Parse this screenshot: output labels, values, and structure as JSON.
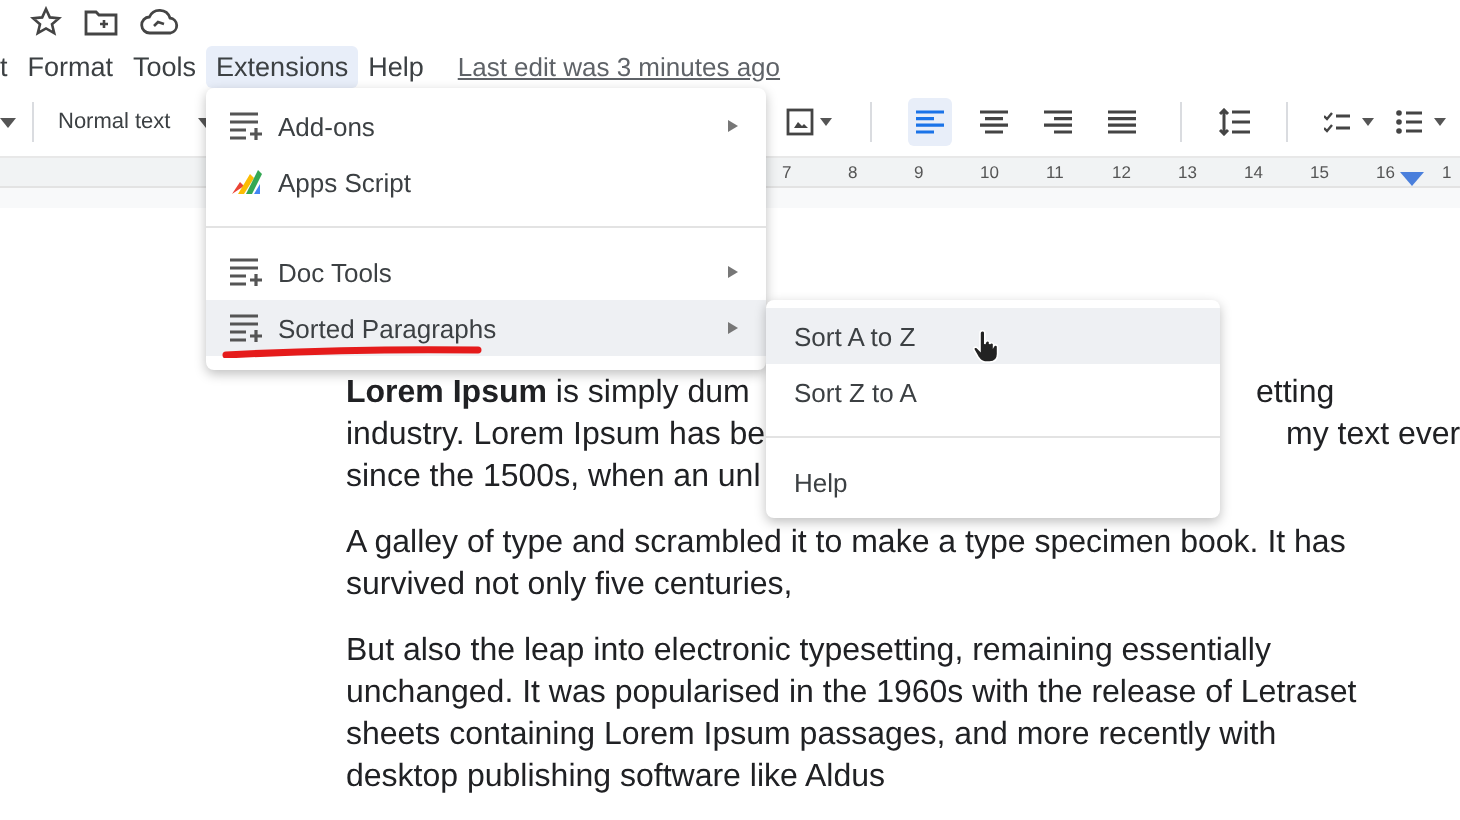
{
  "menu_bar": {
    "items": [
      {
        "label": "t",
        "selected": false
      },
      {
        "label": "Format",
        "selected": false
      },
      {
        "label": "Tools",
        "selected": false
      },
      {
        "label": "Extensions",
        "selected": true
      },
      {
        "label": "Help",
        "selected": false
      }
    ],
    "last_edit": "Last edit was 3 minutes ago"
  },
  "toolbar": {
    "style_dropdown": "Normal text",
    "align_buttons": [
      {
        "kind": "left",
        "selected": true
      },
      {
        "kind": "center",
        "selected": false
      },
      {
        "kind": "right",
        "selected": false
      },
      {
        "kind": "justify",
        "selected": false
      }
    ]
  },
  "ruler": {
    "marks": [
      "7",
      "8",
      "9",
      "10",
      "11",
      "12",
      "13",
      "14",
      "15",
      "16",
      "1"
    ]
  },
  "extensions_menu": {
    "sections": [
      [
        {
          "label": "Add-ons",
          "kind": "addon",
          "submenu": true,
          "selected": false
        },
        {
          "label": "Apps Script",
          "kind": "script",
          "submenu": false,
          "selected": false
        }
      ],
      [
        {
          "label": "Doc Tools",
          "kind": "addon",
          "submenu": true,
          "selected": false
        },
        {
          "label": "Sorted Paragraphs",
          "kind": "addon",
          "submenu": true,
          "selected": true
        }
      ]
    ]
  },
  "submenu": {
    "sections": [
      [
        {
          "label": "Sort A to Z",
          "selected": true
        },
        {
          "label": "Sort Z to A",
          "selected": false
        }
      ],
      [
        {
          "label": "Help",
          "selected": false
        }
      ]
    ]
  },
  "document": {
    "paragraphs": [
      [
        {
          "left": "**Lorem Ipsum** is simply dum",
          "right": "etting"
        },
        {
          "left": "industry. Lorem Ipsum has be",
          "right": "my text ever"
        },
        {
          "left": "since the 1500s, when an unl"
        }
      ],
      [
        {
          "left": "A galley of type and scrambled it to make a type specimen book. It has"
        },
        {
          "left": "survived not only five centuries,"
        }
      ],
      [
        {
          "left": "But also the leap into electronic typesetting, remaining essentially"
        },
        {
          "left": "unchanged. It was popularised in the 1960s with the release of Letraset"
        },
        {
          "left": "sheets containing Lorem Ipsum passages, and more recently with"
        },
        {
          "left": "desktop publishing software like Aldus"
        }
      ]
    ]
  }
}
